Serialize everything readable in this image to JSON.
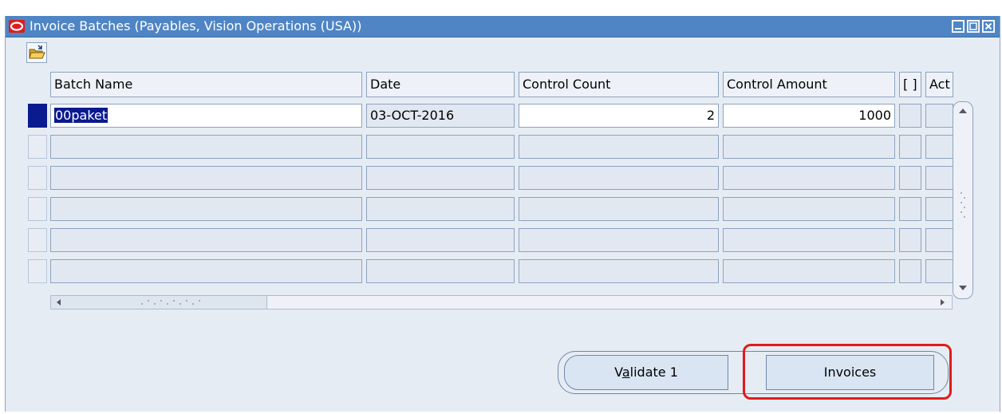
{
  "window": {
    "title": "Invoice Batches (Payables, Vision Operations (USA))"
  },
  "colors": {
    "titlebar": "#4f85c5",
    "selection": "#0a1a8f",
    "highlight": "#e01b1b"
  },
  "toolbar": {
    "folder_icon": "folder-open-icon"
  },
  "table": {
    "headers": {
      "batch_name": "Batch Name",
      "date": "Date",
      "control_count": "Control Count",
      "control_amount": "Control Amount",
      "flex": "[ ]",
      "actual": "Act"
    },
    "rows": [
      {
        "batch_name": "00paket",
        "date": "03-OCT-2016",
        "control_count": "2",
        "control_amount": "1000"
      }
    ]
  },
  "buttons": {
    "validate_pre": "V",
    "validate_mnemonic": "a",
    "validate_post": "lidate 1",
    "invoices": "Invoices"
  }
}
